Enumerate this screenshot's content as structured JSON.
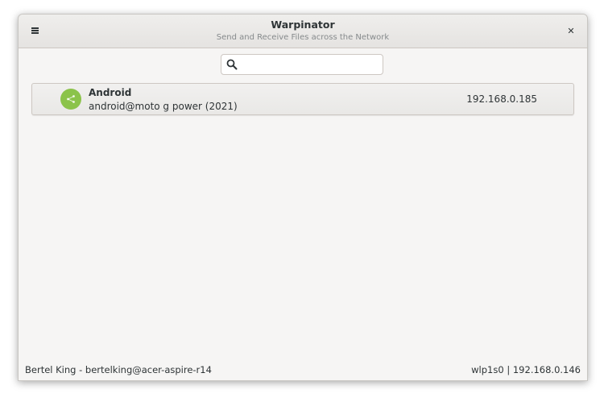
{
  "window": {
    "title": "Warpinator",
    "subtitle": "Send and Receive Files across the Network"
  },
  "headerbar": {
    "menu_icon": "hamburger-menu-icon",
    "close_icon": "close-icon",
    "close_glyph": "✕"
  },
  "search": {
    "value": "",
    "placeholder": "",
    "icon": "search-icon"
  },
  "devices": [
    {
      "name": "Android",
      "host": "android@moto g power (2021)",
      "ip": "192.168.0.185",
      "avatar_color": "#8bc34a",
      "avatar_icon": "share-icon"
    }
  ],
  "statusbar": {
    "user": "Bertel King - bertelking@acer-aspire-r14",
    "network": "wlp1s0 | 192.168.0.146"
  }
}
